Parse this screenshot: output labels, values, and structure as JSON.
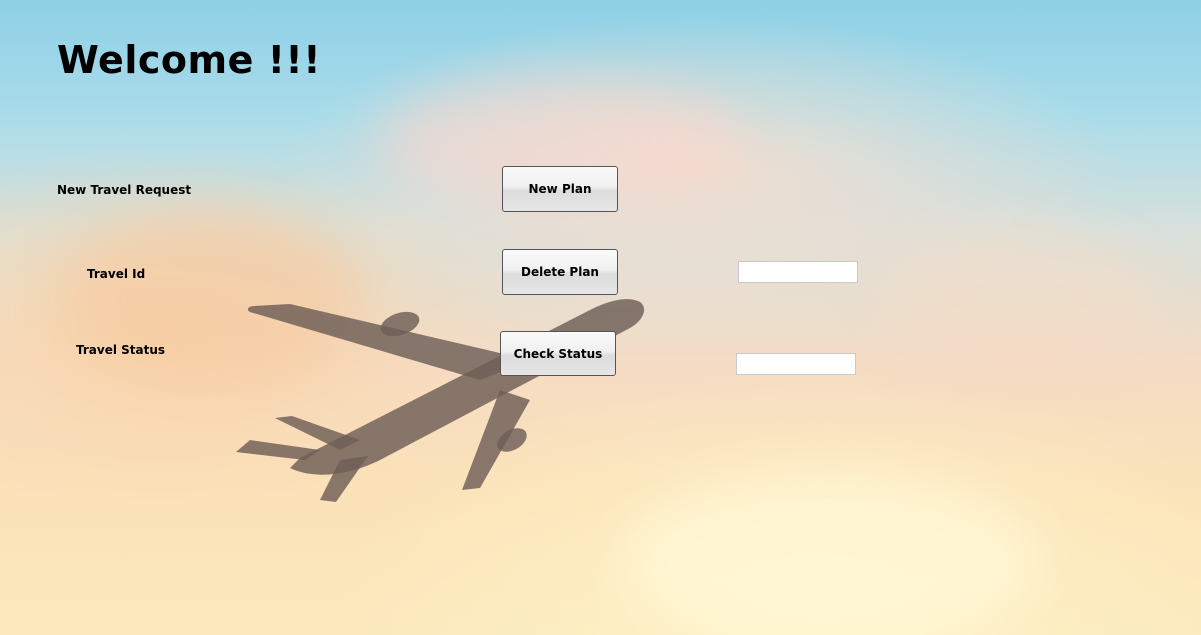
{
  "header": {
    "title": "Welcome !!!"
  },
  "rows": {
    "new_request": {
      "label": "New Travel Request",
      "button_label": "New Plan"
    },
    "travel_id": {
      "label": "Travel Id",
      "button_label": "Delete Plan",
      "input_value": "",
      "input_placeholder": ""
    },
    "travel_status": {
      "label": "Travel Status",
      "button_label": "Check Status",
      "input_value": "",
      "input_placeholder": ""
    }
  },
  "background": {
    "image_icon": "airplane-icon",
    "sky_top_color": "#8fd0e6",
    "sky_bottom_color": "#fbe8bd",
    "plane_color": "#6e5e57"
  }
}
